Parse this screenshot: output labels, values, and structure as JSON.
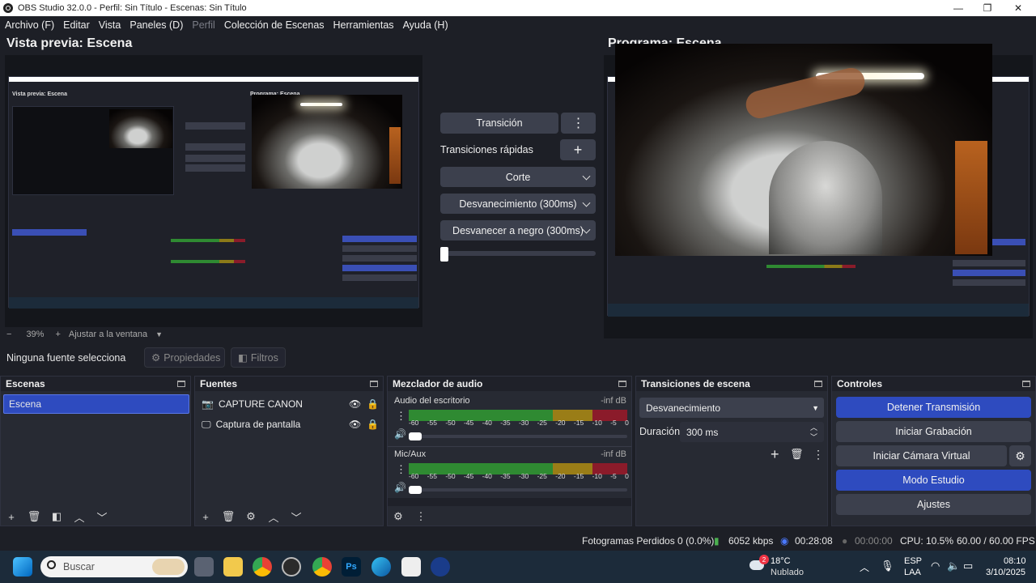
{
  "window": {
    "title": "OBS Studio 32.0.0 - Perfil: Sin Título - Escenas: Sin Título",
    "min": "—",
    "max": "❐",
    "close": "✕"
  },
  "menu": [
    "Archivo (F)",
    "Editar",
    "Vista",
    "Paneles (D)",
    "Perfil",
    "Colección de Escenas",
    "Herramientas",
    "Ayuda (H)"
  ],
  "preview": {
    "title": "Vista previa: Escena",
    "program_title": "Programa: Escena",
    "zoom": "39%",
    "fit": "Ajustar a la ventana",
    "minus": "−",
    "plus": "+"
  },
  "transitions_mid": {
    "transition_btn": "Transición",
    "quick_label": "Transiciones rápidas",
    "items": [
      "Corte",
      "Desvanecimiento (300ms)",
      "Desvanecer a negro (300ms)"
    ],
    "slider_level": 0
  },
  "source_bar": {
    "none": "Ninguna fuente selecciona",
    "props": "Propiedades",
    "filters": "Filtros"
  },
  "scenes": {
    "title": "Escenas",
    "items": [
      "Escena"
    ]
  },
  "sources": {
    "title": "Fuentes",
    "items": [
      "CAPTURE CANON",
      "Captura de pantalla"
    ]
  },
  "mixer": {
    "title": "Mezclador de audio",
    "channels": [
      {
        "name": "Audio del escritorio",
        "level": "-inf dB"
      },
      {
        "name": "Mic/Aux",
        "level": "-inf dB"
      }
    ],
    "ticks": [
      "-60",
      "-55",
      "-50",
      "-45",
      "-40",
      "-35",
      "-30",
      "-25",
      "-20",
      "-15",
      "-10",
      "-5",
      "0"
    ]
  },
  "scene_trans": {
    "title": "Transiciones de escena",
    "selected": "Desvanecimiento",
    "duration_label": "Duración",
    "duration": "300 ms"
  },
  "controls": {
    "title": "Controles",
    "stop_stream": "Detener Transmisión",
    "start_rec": "Iniciar Grabación",
    "start_vcam": "Iniciar Cámara Virtual",
    "studio": "Modo Estudio",
    "settings": "Ajustes"
  },
  "status": {
    "dropped": "Fotogramas Perdidos 0 (0.0%)",
    "bitrate": "6052 kbps",
    "stream_time": "00:28:08",
    "rec_time": "00:00:00",
    "cpu": "CPU: 10.5%",
    "fps": "60.00 / 60.00 FPS"
  },
  "taskbar": {
    "search": "Buscar",
    "weather_temp": "18°C",
    "weather_desc": "Nublado",
    "weather_badge": "2",
    "lang1": "ESP",
    "lang2": "LAA",
    "time": "08:10",
    "date": "3/10/2025"
  },
  "colors": {
    "accent": "#2e4bbf",
    "meter_green": "#2f8a32",
    "meter_yellow": "#9a7d17",
    "meter_red": "#8b1b2a"
  }
}
